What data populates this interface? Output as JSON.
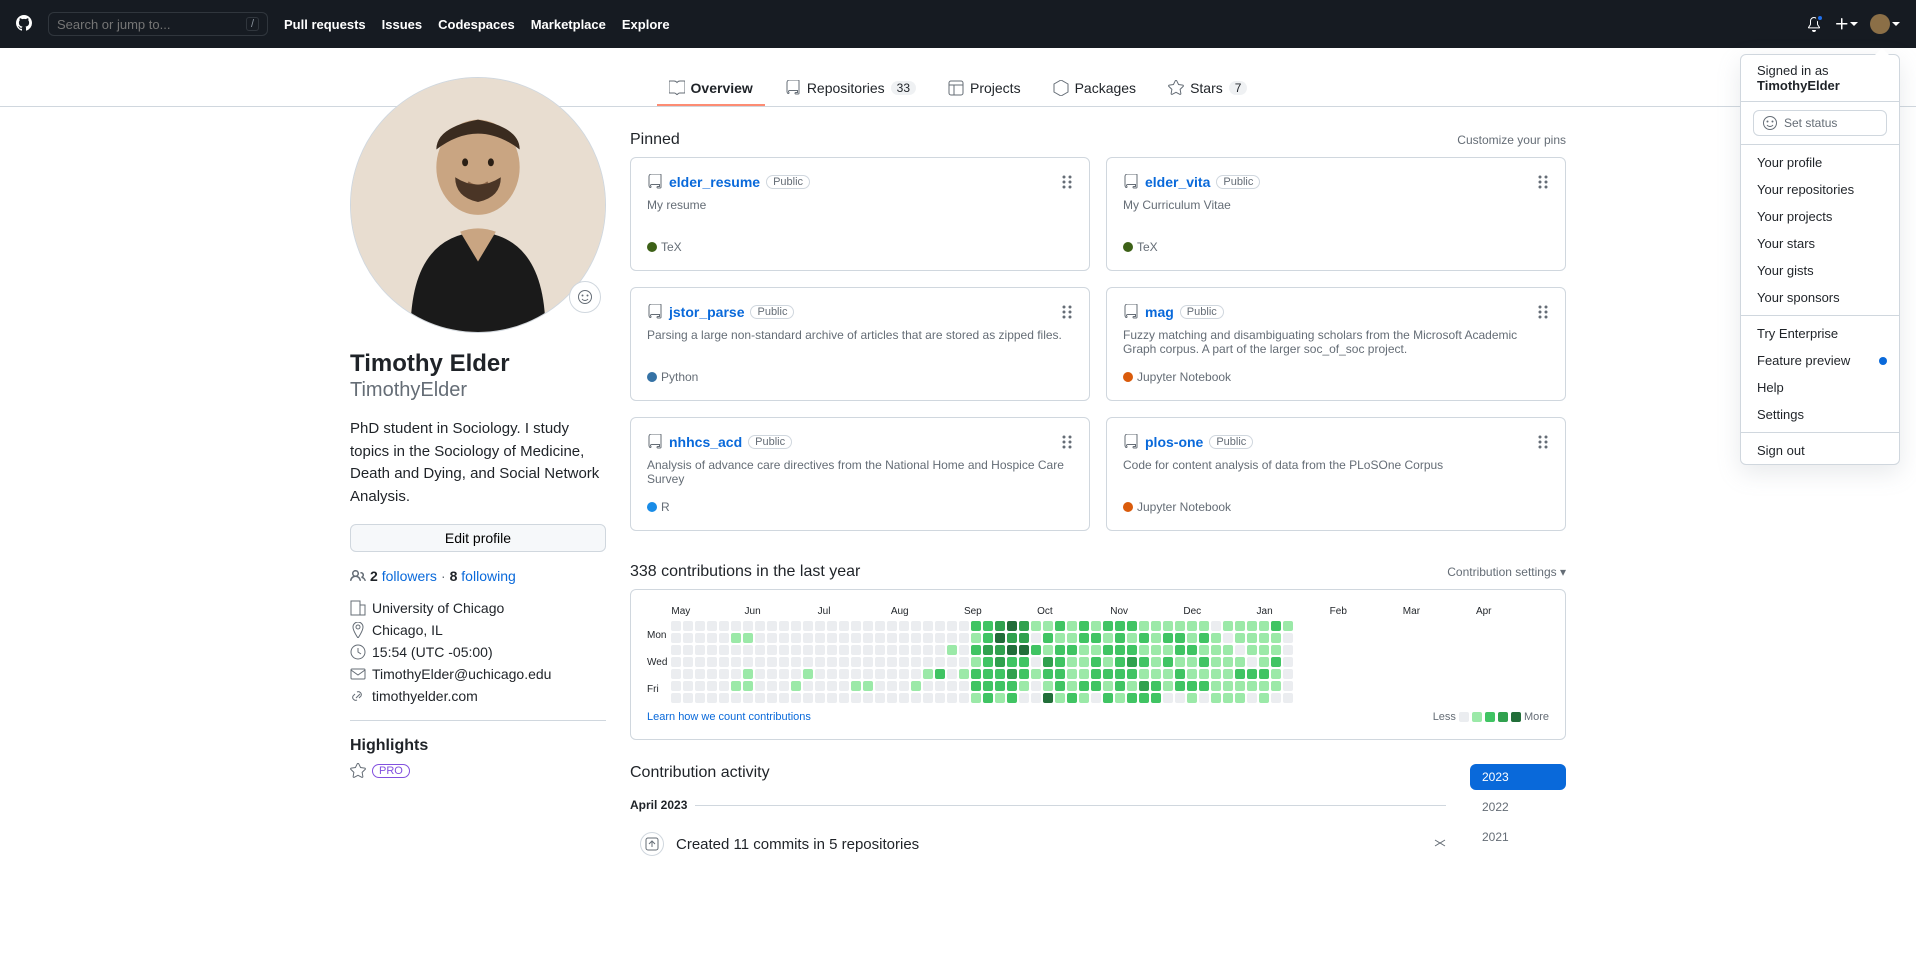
{
  "header": {
    "search_placeholder": "Search or jump to...",
    "nav": [
      "Pull requests",
      "Issues",
      "Codespaces",
      "Marketplace",
      "Explore"
    ]
  },
  "dropdown": {
    "signed_in_as": "Signed in as",
    "username": "TimothyElder",
    "set_status": "Set status",
    "items_1": [
      "Your profile",
      "Your repositories",
      "Your projects",
      "Your stars",
      "Your gists",
      "Your sponsors"
    ],
    "items_2": [
      "Try Enterprise",
      "Feature preview",
      "Help",
      "Settings"
    ],
    "feature_preview_label": "Feature preview",
    "sign_out": "Sign out"
  },
  "tabs": {
    "overview": "Overview",
    "repositories": "Repositories",
    "repo_count": "33",
    "projects": "Projects",
    "packages": "Packages",
    "stars": "Stars",
    "star_count": "7"
  },
  "profile": {
    "name": "Timothy Elder",
    "login": "TimothyElder",
    "bio": "PhD student in Sociology. I study topics in the Sociology of Medicine, Death and Dying, and Social Network Analysis.",
    "edit_button": "Edit profile",
    "followers_count": "2",
    "followers_label": "followers",
    "following_count": "8",
    "following_label": "following",
    "org": "University of Chicago",
    "location": "Chicago, IL",
    "time": "15:54 (UTC -05:00)",
    "email": "TimothyElder@uchicago.edu",
    "website": "timothyelder.com",
    "highlights_title": "Highlights",
    "pro_label": "PRO"
  },
  "pinned": {
    "title": "Pinned",
    "customize": "Customize your pins",
    "repos": [
      {
        "name": "elder_resume",
        "visibility": "Public",
        "desc": "My resume",
        "lang": "TeX",
        "color": "#3D6117"
      },
      {
        "name": "elder_vita",
        "visibility": "Public",
        "desc": "My Curriculum Vitae",
        "lang": "TeX",
        "color": "#3D6117"
      },
      {
        "name": "jstor_parse",
        "visibility": "Public",
        "desc": "Parsing a large non-standard archive of articles that are stored as zipped files.",
        "lang": "Python",
        "color": "#3572A5"
      },
      {
        "name": "mag",
        "visibility": "Public",
        "desc": "Fuzzy matching and disambiguating scholars from the Microsoft Academic Graph corpus. A part of the larger soc_of_soc project.",
        "lang": "Jupyter Notebook",
        "color": "#DA5B0B"
      },
      {
        "name": "nhhcs_acd",
        "visibility": "Public",
        "desc": "Analysis of advance care directives from the National Home and Hospice Care Survey",
        "lang": "R",
        "color": "#198CE7"
      },
      {
        "name": "plos-one",
        "visibility": "Public",
        "desc": "Code for content analysis of data from the PLoSOne Corpus",
        "lang": "Jupyter Notebook",
        "color": "#DA5B0B"
      }
    ]
  },
  "contrib": {
    "title": "338 contributions in the last year",
    "settings": "Contribution settings",
    "months": [
      "May",
      "Jun",
      "Jul",
      "Aug",
      "Sep",
      "Oct",
      "Nov",
      "Dec",
      "Jan",
      "Feb",
      "Mar",
      "Apr"
    ],
    "days": [
      "Mon",
      "Wed",
      "Fri"
    ],
    "learn_link": "Learn how we count contributions",
    "less": "Less",
    "more": "More"
  },
  "activity": {
    "title": "Contribution activity",
    "month": "April 2023",
    "commit_text": "Created 11 commits in 5 repositories",
    "years": [
      "2023",
      "2022",
      "2021"
    ]
  }
}
